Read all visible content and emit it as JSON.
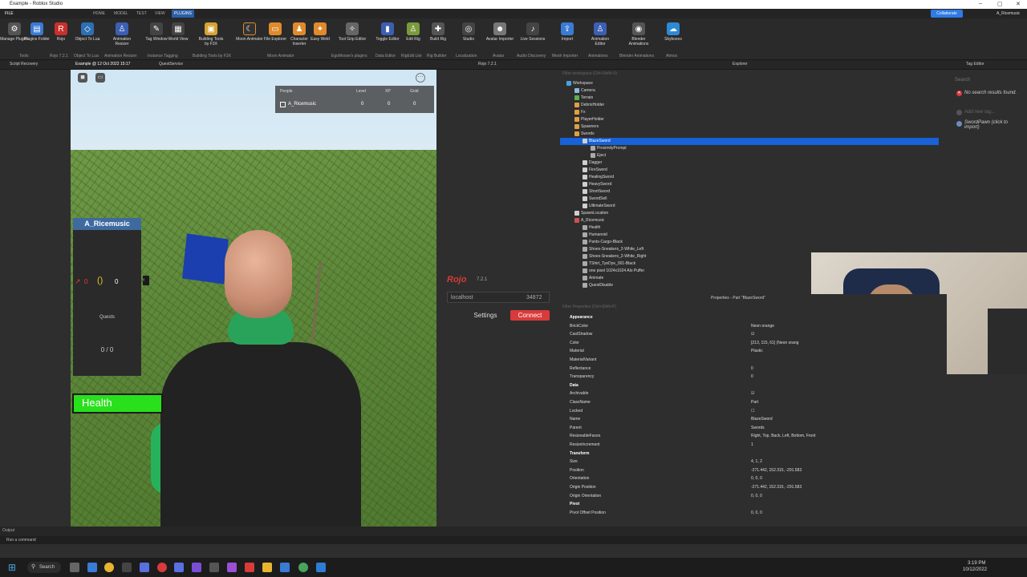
{
  "window": {
    "title": "Example - Roblox Studio"
  },
  "menu": {
    "file": "FILE",
    "tabs": [
      "HOME",
      "MODEL",
      "TEST",
      "VIEW",
      "PLUGINS"
    ],
    "active": "PLUGINS",
    "collaborate": "Collaborate",
    "user": "A_Ricemusic"
  },
  "ribbon": {
    "buttons": [
      "Manage Plugins",
      "Plugins Folder",
      "Rojo",
      "Object To Lua",
      "Animation Resizer",
      "Tag Window",
      "World View",
      "Building Tools by F3X",
      "Moon Animator",
      "File Explorer",
      "Character Inserter",
      "Easy Weld",
      "Tool Grip Editor",
      "Toggle Editor",
      "Edit Rig",
      "Build Rig",
      "Studio",
      "Avatar Importer",
      "Live Sessions",
      "Import",
      "Animation Editor",
      "Blender Animations",
      "Skyboxes"
    ],
    "groups": [
      "Tools",
      "Rojo 7.2.1",
      "Object To Lua",
      "Animation Resizer",
      "Instance Tagging",
      "Building Tools by F3X",
      "Moon Animator",
      "EgoMoose's plugins",
      "Data Editor",
      "RigEdit Lite",
      "Rig Builder",
      "Localization",
      "Avatar",
      "Audio Discovery",
      "Mesh Importer",
      "Animations",
      "Blender Animations",
      "Atmos"
    ]
  },
  "doc_tabs": {
    "script_recovery": "Script Recovery",
    "example": "Example @ 12 Oct 2022 15:17",
    "quest": "QuestService",
    "rojo": "Rojo 7.2.1",
    "explorer": "Explorer",
    "tag_editor": "Tag Editor"
  },
  "game": {
    "leaderboard": {
      "headers": [
        "People",
        "Level",
        "XP",
        "Gold"
      ],
      "player": "A_Ricemusic",
      "level": "0",
      "xp": "0",
      "gold": "0"
    },
    "quest_name": "A_Ricemusic",
    "quest_stat_left": "0",
    "quest_stat_right": "0",
    "quests_label": "Quests",
    "quests_count": "0 / 0",
    "health_label": "Health"
  },
  "rojo": {
    "logo": "Rojo",
    "version": "7.2.1",
    "host": "localhost",
    "port": "34872",
    "settings": "Settings",
    "connect": "Connect"
  },
  "explorer": {
    "filter": "Filter workspace (Ctrl+Shift+X)",
    "items": [
      {
        "label": "Workspace",
        "depth": 0,
        "color": "#4aa3e0"
      },
      {
        "label": "Camera",
        "depth": 1,
        "color": "#8fb8e0"
      },
      {
        "label": "Terrain",
        "depth": 1,
        "color": "#5fae4f"
      },
      {
        "label": "DebrisHolder",
        "depth": 1,
        "color": "#e0a040"
      },
      {
        "label": "Fx",
        "depth": 1,
        "color": "#e0a040"
      },
      {
        "label": "PlayerHolder",
        "depth": 1,
        "color": "#e0a040"
      },
      {
        "label": "Spawners",
        "depth": 1,
        "color": "#e0a040"
      },
      {
        "label": "Swords",
        "depth": 1,
        "color": "#e0a040"
      },
      {
        "label": "BlazeSword",
        "depth": 2,
        "color": "#cfcfcf",
        "selected": true
      },
      {
        "label": "ProximityPrompt",
        "depth": 3,
        "color": "#aaaaaa"
      },
      {
        "label": "Eject",
        "depth": 3,
        "color": "#aaaaaa"
      },
      {
        "label": "Dagger",
        "depth": 2,
        "color": "#cfcfcf"
      },
      {
        "label": "FireSword",
        "depth": 2,
        "color": "#cfcfcf"
      },
      {
        "label": "HealingSword",
        "depth": 2,
        "color": "#cfcfcf"
      },
      {
        "label": "HeavySword",
        "depth": 2,
        "color": "#cfcfcf"
      },
      {
        "label": "ShortSword",
        "depth": 2,
        "color": "#cfcfcf"
      },
      {
        "label": "SwordSell",
        "depth": 2,
        "color": "#cfcfcf"
      },
      {
        "label": "UltimateSword",
        "depth": 2,
        "color": "#cfcfcf"
      },
      {
        "label": "SpawnLocation",
        "depth": 1,
        "color": "#cfcfcf"
      },
      {
        "label": "A_Ricemusic",
        "depth": 1,
        "color": "#d05050"
      },
      {
        "label": "Health",
        "depth": 2,
        "color": "#aaaaaa"
      },
      {
        "label": "Humanoid",
        "depth": 2,
        "color": "#aaaaaa"
      },
      {
        "label": "Pants-Cargo-Black",
        "depth": 2,
        "color": "#aaaaaa"
      },
      {
        "label": "Shoes-Sneakers_2-White_Left",
        "depth": 2,
        "color": "#aaaaaa"
      },
      {
        "label": "Shoes-Sneakers_2-White_Right",
        "depth": 2,
        "color": "#aaaaaa"
      },
      {
        "label": "TShirt_TyeDye_001-Black",
        "depth": 2,
        "color": "#aaaaaa"
      },
      {
        "label": "one pixel 1024x1024 Alo Puffer",
        "depth": 2,
        "color": "#aaaaaa"
      },
      {
        "label": "Animate",
        "depth": 2,
        "color": "#aaaaaa"
      },
      {
        "label": "QuestDisable",
        "depth": 2,
        "color": "#aaaaaa"
      }
    ]
  },
  "tag_editor": {
    "search_placeholder": "Search",
    "no_results": "No search results found.",
    "add_new_tag": "Add new tag...",
    "swordpawn": "SwordPawn (click to import)"
  },
  "properties": {
    "title": "Properties - Part \"BlazeSword\"",
    "filter": "Filter Properties (Ctrl+Shift+P)",
    "rows": [
      {
        "k": "Appearance",
        "v": "",
        "cat": true
      },
      {
        "k": "BrickColor",
        "v": "Neon orange"
      },
      {
        "k": "CastShadow",
        "v": "☑"
      },
      {
        "k": "Color",
        "v": "[213, 115, 61] (Neon orang"
      },
      {
        "k": "Material",
        "v": "Plastic"
      },
      {
        "k": "MaterialVariant",
        "v": ""
      },
      {
        "k": "Reflectance",
        "v": "0"
      },
      {
        "k": "Transparency",
        "v": "0"
      },
      {
        "k": "Data",
        "v": "",
        "cat": true
      },
      {
        "k": "Archivable",
        "v": "☑"
      },
      {
        "k": "ClassName",
        "v": "Part"
      },
      {
        "k": "Locked",
        "v": "☐"
      },
      {
        "k": "Name",
        "v": "BlazeSword"
      },
      {
        "k": "Parent",
        "v": "Swords"
      },
      {
        "k": "ResizeableFaces",
        "v": "Right, Top, Back, Left, Bottom, Front"
      },
      {
        "k": "ResizeIncrement",
        "v": "1"
      },
      {
        "k": "Transform",
        "v": "",
        "cat": true
      },
      {
        "k": "Size",
        "v": "4, 1, 2"
      },
      {
        "k": "Position",
        "v": "-271.442, 152.315, -291.583"
      },
      {
        "k": "Orientation",
        "v": "0, 0, 0"
      },
      {
        "k": "Origin Position",
        "v": "-271.442, 152.315, -291.583"
      },
      {
        "k": "Origin Orientation",
        "v": "0, 0, 0"
      },
      {
        "k": "Pivot",
        "v": "",
        "cat": true
      },
      {
        "k": "Pivot Offset Position",
        "v": "0, 0, 0"
      }
    ]
  },
  "bottom": {
    "output": "Output",
    "command": "Run a command"
  },
  "taskbar": {
    "search": "Search",
    "time": "3:19 PM",
    "date": "10/12/2022"
  }
}
